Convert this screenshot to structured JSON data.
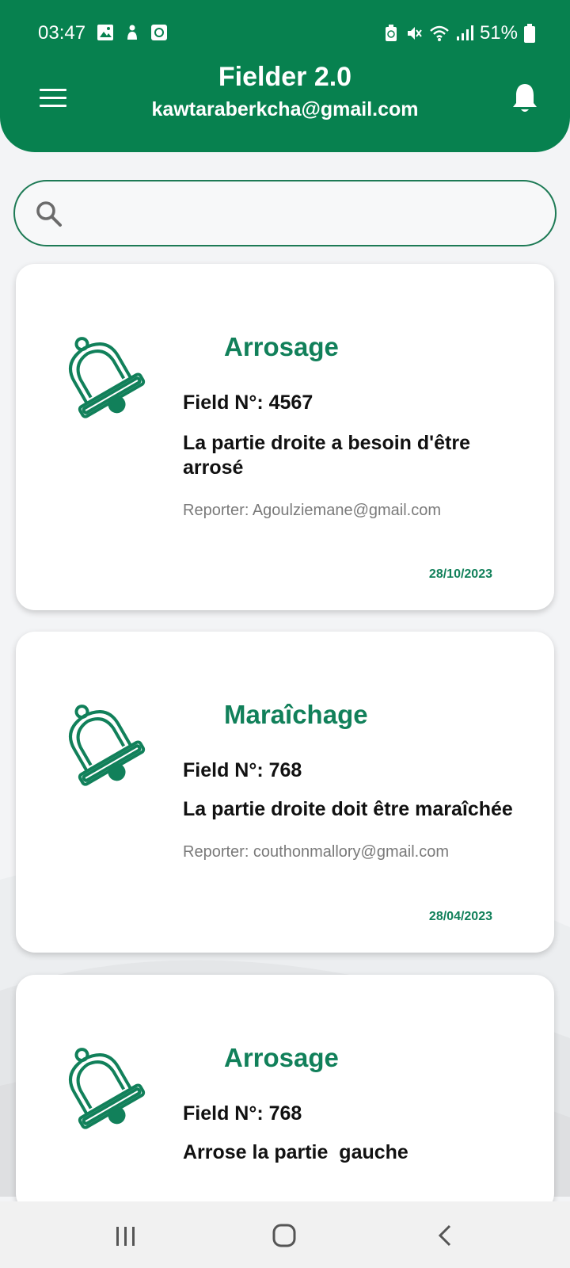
{
  "status": {
    "time": "03:47",
    "battery": "51%"
  },
  "header": {
    "title": "Fielder 2.0",
    "email": "kawtaraberkcha@gmail.com"
  },
  "search": {
    "placeholder": "",
    "value": ""
  },
  "alerts": [
    {
      "type": "Arrosage",
      "field": "Field N°: 4567",
      "description": "La partie droite a besoin d'être arrosé",
      "reporter": "Reporter: Agoulziemane@gmail.com",
      "date": "28/10/2023"
    },
    {
      "type": "Maraîchage",
      "field": "Field N°: 768",
      "description": "La partie droite doit être maraîchée",
      "reporter": "Reporter: couthonmallory@gmail.com",
      "date": "28/04/2023"
    },
    {
      "type": "Arrosage",
      "field": "Field N°: 768",
      "description": "Arrose la partie  gauche",
      "reporter": "",
      "date": ""
    }
  ],
  "colors": {
    "primary": "#07814f",
    "accent_text": "#11805a"
  },
  "icons": {
    "menu": "menu-icon",
    "notifications": "bell-icon",
    "search": "search-icon",
    "card": "bell-outline-icon"
  }
}
